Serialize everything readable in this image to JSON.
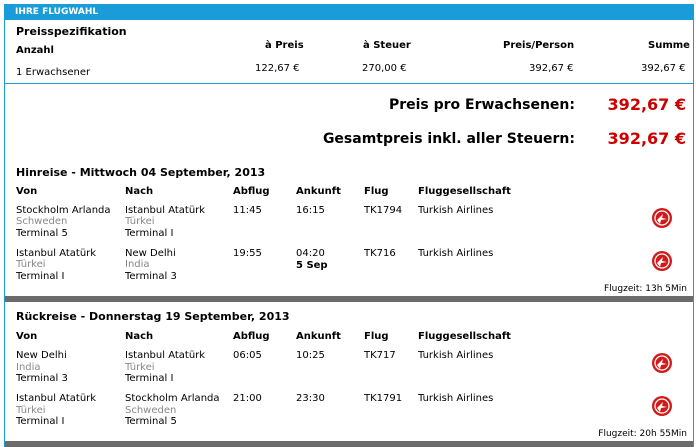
{
  "header": {
    "title": "IHRE FLUGWAHL"
  },
  "price": {
    "section_title": "Preisspezifikation",
    "col_count": "Anzahl",
    "col_unit": "à Preis",
    "col_tax": "à Steuer",
    "col_person": "Preis/Person",
    "col_sum": "Summe",
    "row_label": "1 Erwachsener",
    "row_unit": "122,67 €",
    "row_tax": "270,00 €",
    "row_person": "392,67 €",
    "row_sum": "392,67 €",
    "per_adult_label": "Preis pro Erwachsenen:",
    "per_adult_value": "392,67 €",
    "total_label": "Gesamtpreis inkl. aller Steuern:",
    "total_value": "392,67 €"
  },
  "columns": {
    "from": "Von",
    "to": "Nach",
    "dep": "Abflug",
    "arr": "Ankunft",
    "flight": "Flug",
    "airline": "Fluggesellschaft"
  },
  "outbound": {
    "title": "Hinreise - Mittwoch 04 September, 2013",
    "flights": [
      {
        "from": "Stockholm Arlanda",
        "from_country": "Schweden",
        "from_terminal": "Terminal 5",
        "to": "Istanbul Atatürk",
        "to_country": "Türkei",
        "to_terminal": "Terminal I",
        "dep": "11:45",
        "arr": "16:15",
        "arr_note": "",
        "flight": "TK1794",
        "airline": "Turkish Airlines"
      },
      {
        "from": "Istanbul Atatürk",
        "from_country": "Türkei",
        "from_terminal": "Terminal I",
        "to": "New Delhi",
        "to_country": "India",
        "to_terminal": "Terminal 3",
        "dep": "19:55",
        "arr": "04:20",
        "arr_note": "5 Sep",
        "flight": "TK716",
        "airline": "Turkish Airlines"
      }
    ],
    "duration": "Flugzeit: 13h 5Min"
  },
  "return": {
    "title": "Rückreise - Donnerstag 19 September, 2013",
    "flights": [
      {
        "from": "New Delhi",
        "from_country": "India",
        "from_terminal": "Terminal 3",
        "to": "Istanbul Atatürk",
        "to_country": "Türkei",
        "to_terminal": "Terminal I",
        "dep": "06:05",
        "arr": "10:25",
        "arr_note": "",
        "flight": "TK717",
        "airline": "Turkish Airlines"
      },
      {
        "from": "Istanbul Atatürk",
        "from_country": "Türkei",
        "from_terminal": "Terminal I",
        "to": "Stockholm Arlanda",
        "to_country": "Schweden",
        "to_terminal": "Terminal 5",
        "dep": "21:00",
        "arr": "23:30",
        "arr_note": "",
        "flight": "TK1791",
        "airline": "Turkish Airlines"
      }
    ],
    "duration": "Flugzeit: 20h 55Min"
  },
  "colors": {
    "accent": "#1a9cd8",
    "price_red": "#cc0000",
    "separator": "#6b6b6b",
    "airline_logo": "#d11a1a"
  },
  "icons": {
    "airline_logo": "turkish-airlines-logo-icon"
  }
}
